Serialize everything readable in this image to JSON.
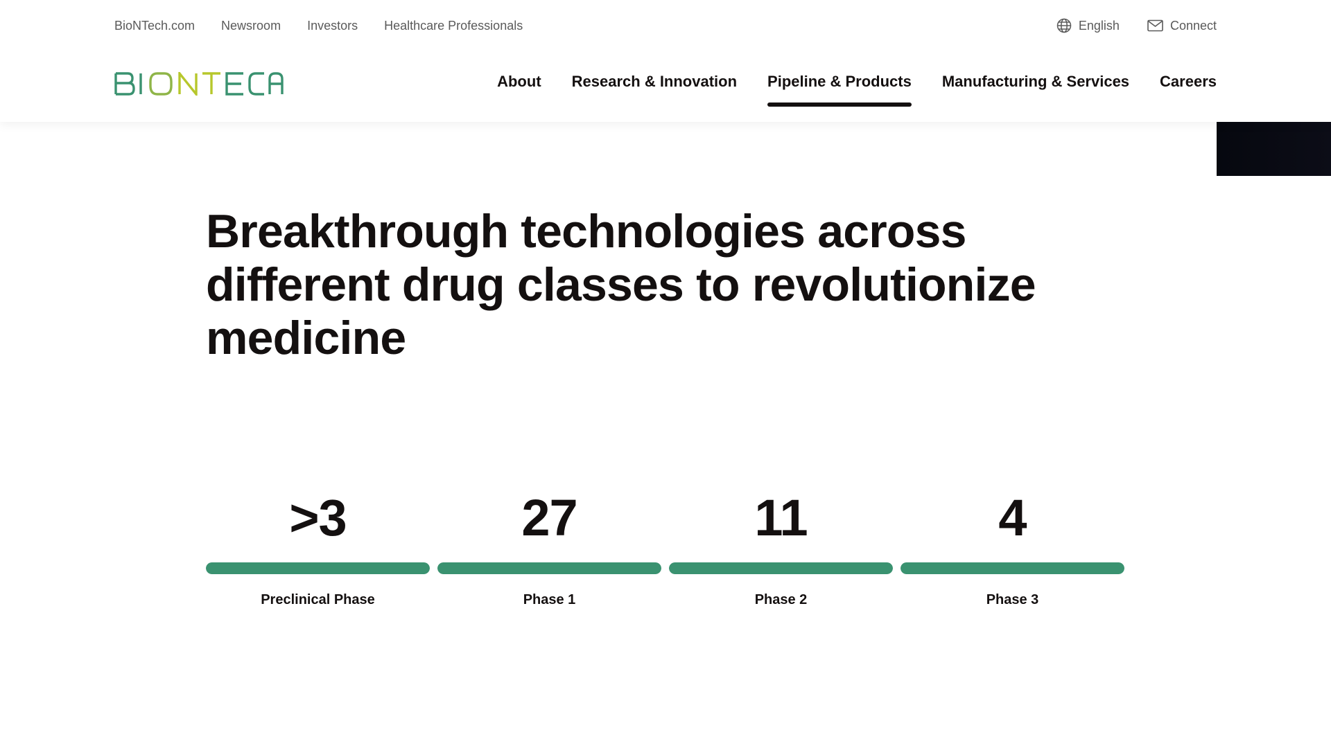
{
  "utility_nav": {
    "links": [
      "BioNTech.com",
      "Newsroom",
      "Investors",
      "Healthcare Professionals"
    ],
    "language": "English",
    "connect": "Connect"
  },
  "brand": {
    "name": "BIONTECH",
    "colors": {
      "green": "#3a9270",
      "lime": "#b7c72c",
      "text": "#141010",
      "muted": "#5a5a5a"
    }
  },
  "main_nav": {
    "items": [
      "About",
      "Research & Innovation",
      "Pipeline & Products",
      "Manufacturing & Services",
      "Careers"
    ],
    "active": "Pipeline & Products"
  },
  "headline": "Breakthrough technologies across different drug classes to revolutionize medicine",
  "pipeline": [
    {
      "value": ">3",
      "label": "Preclinical Phase",
      "fill": 1.0
    },
    {
      "value": "27",
      "label": "Phase 1",
      "fill": 1.0
    },
    {
      "value": "11",
      "label": "Phase 2",
      "fill": 1.0
    },
    {
      "value": "4",
      "label": "Phase 3",
      "fill": 1.0
    }
  ],
  "icons": {
    "language": "globe-icon",
    "connect": "mail-icon"
  }
}
